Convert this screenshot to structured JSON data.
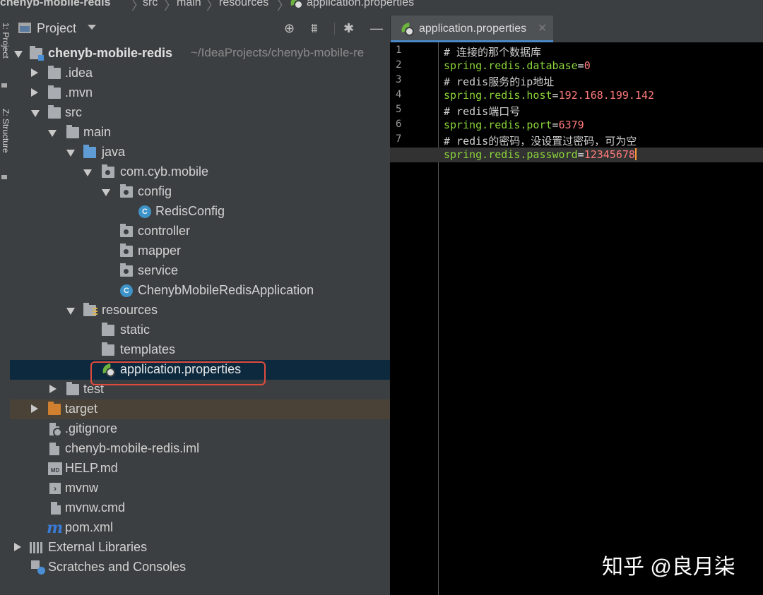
{
  "breadcrumb": [
    "chenyb-mobile-redis",
    "src",
    "main",
    "resources",
    "application.properties"
  ],
  "tool_strip": {
    "project": "1: Project",
    "structure": "Z: Structure"
  },
  "panel": {
    "title": "Project",
    "header_icons": [
      "crosshair-icon",
      "collapse-icon",
      "gear-icon",
      "minimize-icon"
    ]
  },
  "tree": [
    {
      "label": "chenyb-mobile-redis",
      "hint": "~/IdeaProjects/chenyb-mobile-re",
      "icon": "project-folder-icon",
      "expanded": true
    },
    {
      "label": ".idea",
      "icon": "folder-icon",
      "expanded": false
    },
    {
      "label": ".mvn",
      "icon": "folder-icon",
      "expanded": false
    },
    {
      "label": "src",
      "icon": "folder-icon",
      "expanded": true
    },
    {
      "label": "main",
      "icon": "folder-icon",
      "expanded": true
    },
    {
      "label": "java",
      "icon": "source-folder-icon",
      "expanded": true
    },
    {
      "label": "com.cyb.mobile",
      "icon": "package-icon",
      "expanded": true
    },
    {
      "label": "config",
      "icon": "package-icon",
      "expanded": true
    },
    {
      "label": "RedisConfig",
      "icon": "class-icon"
    },
    {
      "label": "controller",
      "icon": "package-icon"
    },
    {
      "label": "mapper",
      "icon": "package-icon"
    },
    {
      "label": "service",
      "icon": "package-icon"
    },
    {
      "label": "ChenybMobileRedisApplication",
      "icon": "spring-boot-class-icon"
    },
    {
      "label": "resources",
      "icon": "resources-folder-icon",
      "expanded": true
    },
    {
      "label": "static",
      "icon": "folder-icon"
    },
    {
      "label": "templates",
      "icon": "folder-icon"
    },
    {
      "label": "application.properties",
      "icon": "spring-properties-icon",
      "selected": true
    },
    {
      "label": "test",
      "icon": "folder-icon",
      "expanded": false
    },
    {
      "label": "target",
      "icon": "excluded-folder-icon",
      "expanded": false
    },
    {
      "label": ".gitignore",
      "icon": "gitignore-file-icon"
    },
    {
      "label": "chenyb-mobile-redis.iml",
      "icon": "iml-file-icon"
    },
    {
      "label": "HELP.md",
      "icon": "markdown-file-icon"
    },
    {
      "label": "mvnw",
      "icon": "shell-script-icon"
    },
    {
      "label": "mvnw.cmd",
      "icon": "text-file-icon"
    },
    {
      "label": "pom.xml",
      "icon": "maven-icon"
    },
    {
      "label": "External Libraries",
      "icon": "libraries-icon",
      "expanded": false
    },
    {
      "label": "Scratches and Consoles",
      "icon": "scratches-icon"
    }
  ],
  "editor": {
    "tab_label": "application.properties",
    "lines": [
      {
        "n": "1",
        "comment": "# 连接的那个数据库"
      },
      {
        "n": "2",
        "key": "spring.redis.database",
        "eq": "=",
        "value": "0"
      },
      {
        "n": "3",
        "comment": "# redis服务的ip地址"
      },
      {
        "n": "4",
        "key": "spring.redis.host",
        "eq": "=",
        "value": "192.168.199.142"
      },
      {
        "n": "5",
        "comment": "# redis端口号"
      },
      {
        "n": "6",
        "key": "spring.redis.port",
        "eq": "=",
        "value": "6379"
      },
      {
        "n": "7",
        "comment": "# redis的密码，没设置过密码，可为空"
      },
      {
        "n": "",
        "key": "spring.redis.password",
        "eq": "=",
        "value": "12345678",
        "current": true
      }
    ]
  },
  "watermark": "知乎 @良月柒",
  "colors": {
    "panel_bg": "#3c3f41",
    "editor_bg": "#000000",
    "selection": "#0d293e",
    "key": "#8bd53a",
    "value": "#ff7a7a",
    "highlight_box": "#e04b3c"
  }
}
